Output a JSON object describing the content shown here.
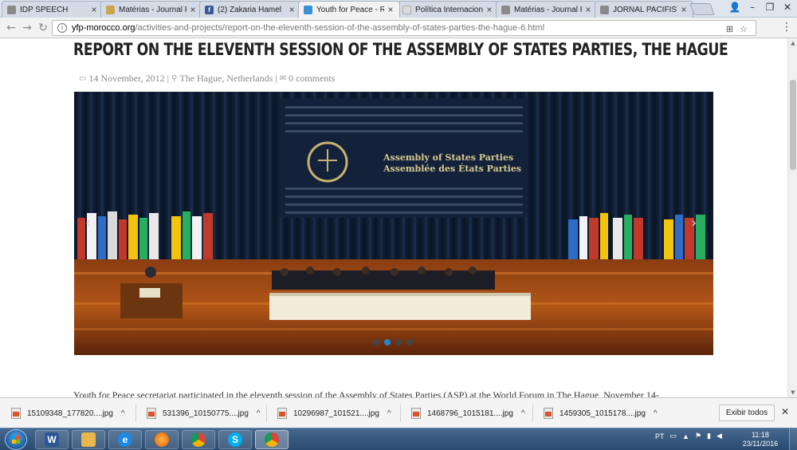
{
  "browser": {
    "tabs": [
      {
        "label": "IDP SPEECH",
        "icon": "document-icon",
        "color": "#7a7a7a"
      },
      {
        "label": "Matérias - Journal P",
        "icon": "site-icon",
        "color": "#c9a552"
      },
      {
        "label": "(2) Zakaria Hamel",
        "icon": "facebook-icon",
        "color": "#3b5998"
      },
      {
        "label": "Youth for Peace - R",
        "icon": "site-icon",
        "color": "#3a8fd6"
      },
      {
        "label": "Política Internaciona",
        "icon": "site-icon",
        "color": "#d9d9d9"
      },
      {
        "label": "Matérias - Journal P",
        "icon": "document-icon",
        "color": "#7a7a7a"
      },
      {
        "label": "JORNAL PACIFISTA",
        "icon": "document-icon",
        "color": "#7a7a7a"
      }
    ],
    "active_tab": 3,
    "close_glyph": "×",
    "address": {
      "domain": "yfp-morocco.org",
      "path": "/activities-and-projects/report-on-the-eleventh-session-of-the-assembly-of-states-parties-the-hague-6.html"
    }
  },
  "article": {
    "title": "REPORT ON THE ELEVENTH SESSION OF THE ASSEMBLY OF STATES PARTIES, THE HAGUE",
    "date": "14 November, 2012",
    "location": "The Hague, Netherlands",
    "comments": "0 comments",
    "separator": "|",
    "photo": {
      "screen_line1": "Assembly of States Parties",
      "screen_line2": "Assemblée des États Parties",
      "slide_count": 4,
      "active_slide": 1
    },
    "body_start": "Youth for Peace secretariat participated in the eleventh session of the Assembly of States Parties (ASP) at the  World Forum in The Hague, November 14-"
  },
  "downloads": {
    "items": [
      "15109348_177820....jpg",
      "531396_10150775....jpg",
      "10296987_101521....jpg",
      "1468796_1015181....jpg",
      "1459305_1015178....jpg"
    ],
    "show_all": "Exibir todos"
  },
  "taskbar": {
    "apps": [
      {
        "name": "word",
        "letter": "W",
        "color": "#2b5797"
      },
      {
        "name": "explorer",
        "letter": "",
        "color": "#e8b64c"
      },
      {
        "name": "ie",
        "letter": "e",
        "color": "#1e88e5"
      },
      {
        "name": "firefox",
        "letter": "",
        "color": "#e66000"
      },
      {
        "name": "chrome",
        "letter": "",
        "color": "#4caf50"
      },
      {
        "name": "skype",
        "letter": "S",
        "color": "#00aff0"
      },
      {
        "name": "chrome-active",
        "letter": "",
        "color": "#4caf50"
      }
    ],
    "language": "PT",
    "time": "11:18",
    "date": "23/11/2016"
  }
}
